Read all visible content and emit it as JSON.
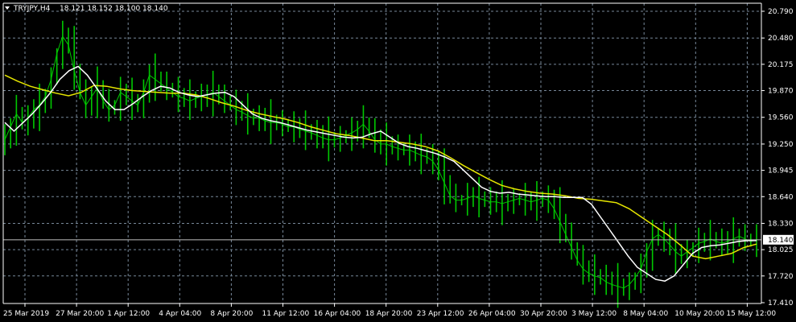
{
  "header": {
    "symbol": "TRYJPY,H4",
    "ohlc": "18.121 18.152 18.100 18.140"
  },
  "chart_data": {
    "type": "candlestick-line",
    "title": "TRYJPY,H4",
    "ohlc_readout": {
      "open": 18.121,
      "high": 18.152,
      "low": 18.1,
      "close": 18.14
    },
    "current_price": 18.14,
    "current_price_label": "18.140",
    "ylim": [
      17.41,
      20.79
    ],
    "y_ticks": [
      "20.790",
      "20.480",
      "20.175",
      "19.870",
      "19.560",
      "19.250",
      "18.945",
      "18.640",
      "18.330",
      "18.025",
      "17.720",
      "17.410"
    ],
    "x_ticks": [
      "25 Mar 2019",
      "27 Mar 20:00",
      "1 Apr 12:00",
      "4 Apr 04:00",
      "8 Apr 20:00",
      "11 Apr 12:00",
      "16 Apr 04:00",
      "18 Apr 20:00",
      "23 Apr 12:00",
      "26 Apr 04:00",
      "30 Apr 20:00",
      "3 May 12:00",
      "8 May 04:00",
      "10 May 20:00",
      "15 May 12:00"
    ],
    "grid": true,
    "colors": {
      "background": "#000000",
      "price": "#00c800",
      "fast_ma": "#ffffff",
      "slow_ma": "#e6e600",
      "grid": "#778899",
      "price_line": "#c0c0c0"
    },
    "series": [
      {
        "values": [
          19.3,
          19.45,
          19.6,
          19.5,
          19.55,
          19.65,
          19.7,
          19.8,
          20.0,
          20.3,
          20.5,
          20.4,
          20.1,
          19.85,
          19.7,
          19.8,
          19.9,
          19.75,
          19.65,
          19.7,
          19.85,
          19.8,
          19.75,
          19.7,
          19.85,
          20.05,
          20.0,
          19.95,
          19.9,
          19.85,
          19.8,
          19.78,
          19.75,
          19.78,
          19.8,
          19.82,
          19.85,
          19.8,
          19.75,
          19.7,
          19.65,
          19.62,
          19.58,
          19.55,
          19.55,
          19.52,
          19.5,
          19.5,
          19.48,
          19.45,
          19.45,
          19.42,
          19.4,
          19.38,
          19.35,
          19.32,
          19.3,
          19.3,
          19.32,
          19.35,
          19.38,
          19.42,
          19.48,
          19.4,
          19.3,
          19.25,
          19.25,
          19.22,
          19.2,
          19.18,
          19.18,
          19.15,
          19.12,
          19.1,
          19.05,
          18.95,
          18.8,
          18.65,
          18.6,
          18.6,
          18.62,
          18.65,
          18.62,
          18.6,
          18.58,
          18.58,
          18.56,
          18.58,
          18.6,
          18.62,
          18.6,
          18.58,
          18.6,
          18.62,
          18.6,
          18.5,
          18.35,
          18.2,
          18.05,
          17.9,
          17.8,
          17.75,
          17.72,
          17.7,
          17.65,
          17.62,
          17.6,
          17.58,
          17.62,
          17.7,
          17.8,
          18.0,
          18.15,
          18.2,
          18.15,
          18.08,
          18.0,
          17.95,
          18.0,
          18.05,
          18.1,
          18.12,
          18.15,
          18.12,
          18.1,
          18.12,
          18.15,
          18.18,
          18.15,
          18.12,
          18.14
        ]
      },
      {
        "values": [
          19.5,
          19.4,
          19.5,
          19.6,
          19.72,
          19.85,
          20.0,
          20.1,
          20.15,
          20.05,
          19.9,
          19.75,
          19.65,
          19.65,
          19.72,
          19.8,
          19.87,
          19.92,
          19.9,
          19.85,
          19.82,
          19.8,
          19.82,
          19.84,
          19.85,
          19.8,
          19.7,
          19.6,
          19.55,
          19.52,
          19.5,
          19.47,
          19.44,
          19.41,
          19.39,
          19.37,
          19.35,
          19.33,
          19.32,
          19.33,
          19.37,
          19.4,
          19.33,
          19.26,
          19.22,
          19.2,
          19.17,
          19.14,
          19.1,
          19.05,
          18.95,
          18.85,
          18.75,
          18.7,
          18.68,
          18.69,
          18.67,
          18.66,
          18.65,
          18.64,
          18.64,
          18.63,
          18.63,
          18.63,
          18.55,
          18.4,
          18.25,
          18.1,
          17.95,
          17.82,
          17.75,
          17.68,
          17.66,
          17.72,
          17.85,
          17.98,
          18.05,
          18.07,
          18.08,
          18.1,
          18.12,
          18.13,
          18.13
        ]
      },
      {
        "values": [
          20.05,
          19.98,
          19.92,
          19.88,
          19.84,
          19.81,
          19.85,
          19.93,
          19.92,
          19.89,
          19.87,
          19.86,
          19.85,
          19.84,
          19.84,
          19.82,
          19.78,
          19.73,
          19.69,
          19.64,
          19.6,
          19.57,
          19.54,
          19.5,
          19.45,
          19.41,
          19.37,
          19.35,
          19.32,
          19.29,
          19.29,
          19.27,
          19.25,
          19.22,
          19.17,
          19.09,
          19.0,
          18.92,
          18.84,
          18.77,
          18.73,
          18.7,
          18.68,
          18.67,
          18.65,
          18.62,
          18.61,
          18.59,
          18.57,
          18.5,
          18.4,
          18.3,
          18.2,
          18.08,
          17.95,
          17.92,
          17.95,
          17.98,
          18.05,
          18.09
        ]
      }
    ]
  }
}
